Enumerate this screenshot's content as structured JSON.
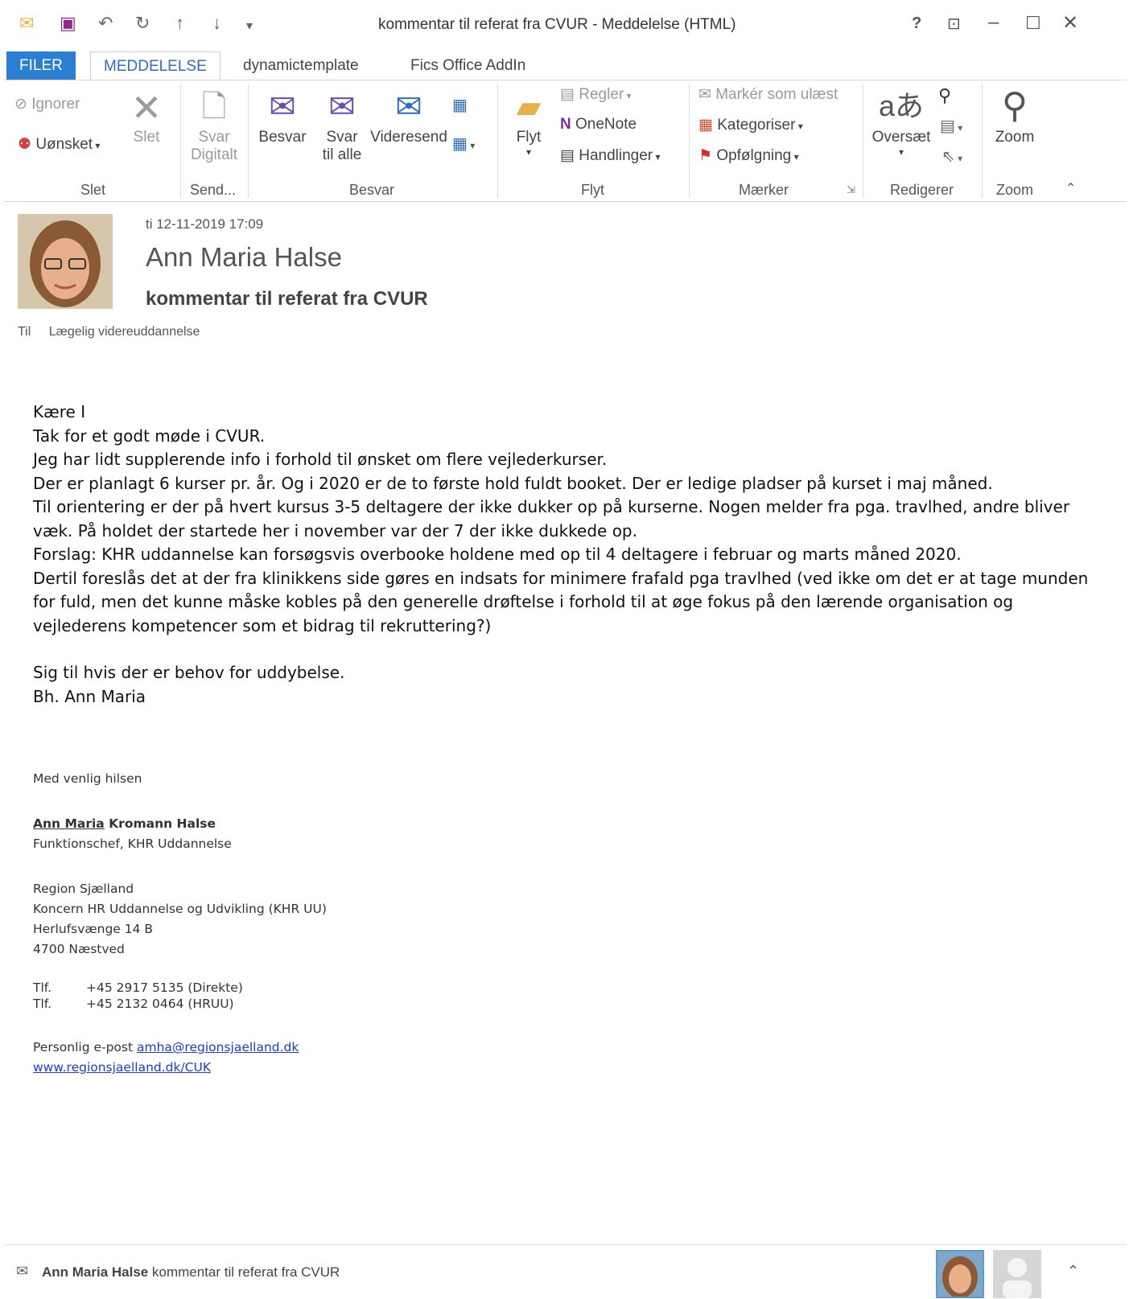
{
  "window": {
    "title": "kommentar til referat fra CVUR - Meddelelse (HTML)"
  },
  "qat": {
    "mail_icon": "envelope-icon",
    "save_icon": "save-icon",
    "undo_icon": "undo-icon",
    "redo_icon": "redo-icon"
  },
  "tabs": [
    "FILER",
    "MEDDELELSE",
    "dynamictemplate",
    "Fics Office AddIn"
  ],
  "ribbon": {
    "slet": {
      "ignorer": "Ignorer",
      "uonsket": "Uønsket",
      "slet": "Slet",
      "group": "Slet"
    },
    "send": {
      "svar_digitalt_1": "Svar",
      "svar_digitalt_2": "Digitalt",
      "group": "Send..."
    },
    "besvar": {
      "besvar": "Besvar",
      "svar_alle_1": "Svar",
      "svar_alle_2": "til alle",
      "videresend": "Videresend",
      "group": "Besvar"
    },
    "flyt": {
      "flyt": "Flyt",
      "regler": "Regler",
      "onenote": "OneNote",
      "handlinger": "Handlinger",
      "group": "Flyt"
    },
    "maerker": {
      "marker_ulaest": "Markér som ulæst",
      "kategoriser": "Kategoriser",
      "opfolgning": "Opfølgning",
      "group": "Mærker"
    },
    "redigerer": {
      "oversaet": "Oversæt",
      "group": "Redigerer"
    },
    "zoom": {
      "zoom": "Zoom",
      "group": "Zoom"
    }
  },
  "message": {
    "datetime": "ti 12-11-2019 17:09",
    "sender": "Ann Maria Halse",
    "subject": "kommentar til referat fra CVUR",
    "to_label": "Til",
    "to_value": "Lægelig videreuddannelse",
    "body": [
      "Kære I",
      "Tak for et godt møde i CVUR.",
      "Jeg har lidt supplerende info i forhold til ønsket om flere vejlederkurser.",
      "Der er planlagt 6 kurser pr. år. Og i 2020 er de to første hold fuldt booket. Der er ledige pladser på kurset i maj måned.",
      "Til orientering er der på hvert kursus 3-5 deltagere der ikke dukker op på kurserne. Nogen melder fra pga. travlhed, andre bliver væk. På holdet der startede her i november var der 7 der ikke dukkede op.",
      "Forslag: KHR uddannelse kan forsøgsvis overbooke holdene med op til 4 deltagere i februar og marts måned 2020.",
      "Dertil foreslås det at der fra klinikkens side gøres en indsats for minimere frafald pga travlhed (ved ikke om det er at tage munden for fuld, men det kunne måske kobles på den generelle drøftelse i forhold til at øge fokus på den lærende organisation og vejlederens kompetencer som et bidrag til rekruttering?)",
      "Sig til hvis der er behov for uddybelse.",
      "Bh. Ann Maria"
    ],
    "signature": {
      "greeting": "Med venlig hilsen",
      "name_first": "Ann Maria",
      "name_rest": " Kromann Halse",
      "role": "Funktionschef, KHR Uddannelse",
      "org": "Region Sjælland",
      "dept": "Koncern HR Uddannelse og Udvikling (KHR UU)",
      "street": "Herlufsvænge 14 B",
      "city": "4700 Næstved",
      "tlf_label": "Tlf.",
      "phone1": "+45 2917 5135 (Direkte)",
      "phone2": "+45 2132 0464 (HRUU)",
      "email_label": "Personlig e-post ",
      "email": "amha@regionsjaelland.dk",
      "web": "www.regionsjaelland.dk/CUK"
    }
  },
  "bottom": {
    "sender": "Ann Maria Halse",
    "subject": " kommentar til referat fra CVUR"
  },
  "colors": {
    "accent": "#2b7fd3",
    "link": "#1a3fc7",
    "flag": "#d0312d"
  }
}
